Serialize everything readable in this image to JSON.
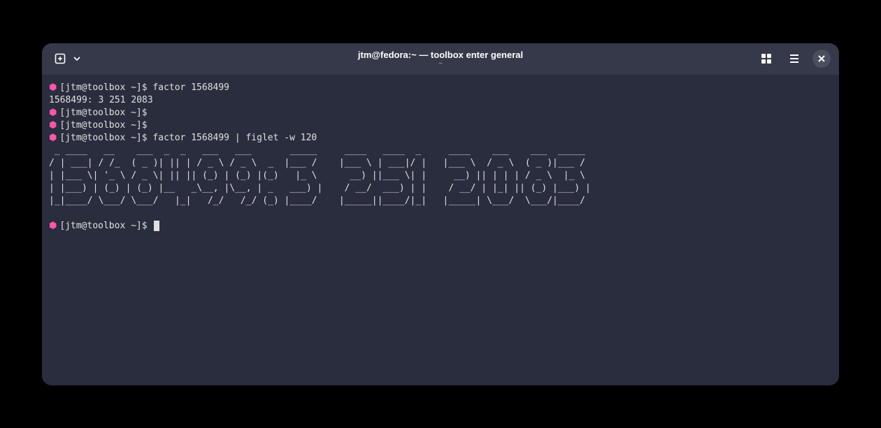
{
  "window": {
    "title": "jtm@fedora:~ — toolbox enter general",
    "subtitle": "~"
  },
  "colors": {
    "prompt_hexagon": "#ff55aa",
    "text": "#e0e0e0",
    "background": "#2a2d3e",
    "titlebar": "#363949"
  },
  "terminal": {
    "lines": [
      {
        "type": "prompt",
        "user": "[jtm@toolbox ~]$",
        "command": "factor 1568499"
      },
      {
        "type": "output",
        "text": "1568499: 3 251 2083"
      },
      {
        "type": "prompt",
        "user": "[jtm@toolbox ~]$",
        "command": ""
      },
      {
        "type": "prompt",
        "user": "[jtm@toolbox ~]$",
        "command": ""
      },
      {
        "type": "prompt",
        "user": "[jtm@toolbox ~]$",
        "command": "factor 1568499 | figlet -w 120"
      }
    ],
    "ascii": " _ ____   __    ___  _  _   ___   ___       _____     ____   ____  _     ____    ___    ___  _____ \n/ | ___| / /_  ( _ )| || | / _ \\ / _ \\  _  |___ /    |___ \\ | ___|/ |   |___ \\  / _ \\  ( _ )|___ / \n| |___ \\| '_ \\ / _ \\| || || (_) | (_) |(_)   |_ \\      __) ||___ \\| |     __) || | | | / _ \\  |_ \\ \n| |___) | (_) | (_) |__   _\\__, |\\__, | _   ___) |    / __/  ___) | |    / __/ | |_| || (_) |___) |\n|_|____/ \\___/ \\___/   |_|   /_/   /_/ (_) |____/    |_____||____/|_|   |_____| \\___/  \\___/|____/ ",
    "final_prompt": {
      "user": "[jtm@toolbox ~]$",
      "command": ""
    }
  }
}
